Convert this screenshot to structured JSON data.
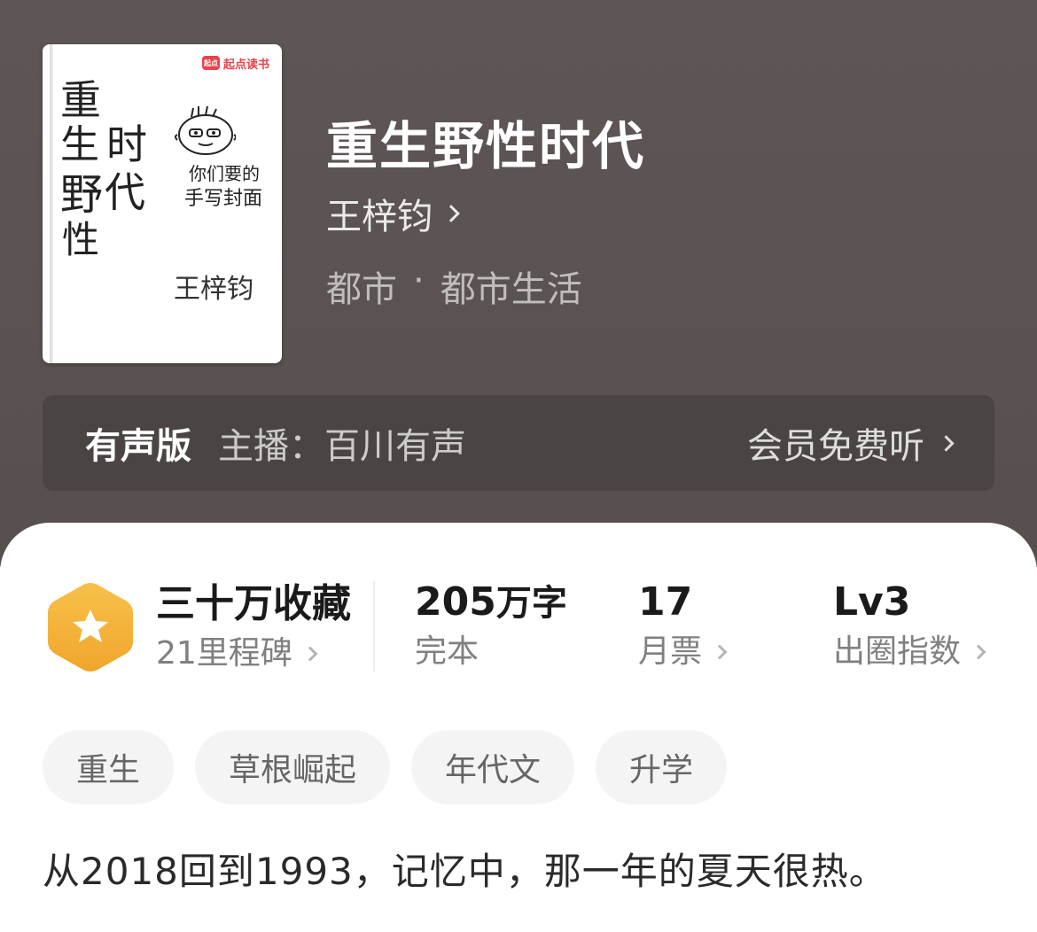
{
  "book": {
    "cover": {
      "brand": "起点读书",
      "brand_mini": "起点",
      "title_chars": [
        "重",
        "生",
        "时",
        "野",
        "性",
        "代"
      ],
      "caption_line1": "你们要的",
      "caption_line2": "手写封面",
      "signature": "王梓钧"
    },
    "title": "重生野性时代",
    "author": "王梓钧",
    "category": "都市",
    "separator": "·",
    "subcategory": "都市生活"
  },
  "audio": {
    "tag": "有声版",
    "narrator": "主播：百川有声",
    "action": "会员免费听"
  },
  "stats": {
    "collect_main": "三十万收藏",
    "collect_sub": "21里程碑",
    "words_num": "205",
    "words_unit": "万字",
    "status": "完本",
    "monthly_num": "17",
    "monthly_label": "月票",
    "level": "Lv3",
    "level_label": "出圈指数"
  },
  "tags": [
    "重生",
    "草根崛起",
    "年代文",
    "升学"
  ],
  "description": "从2018回到1993，记忆中，那一年的夏天很热。",
  "colors": {
    "hero_bg": "#5b5352",
    "audio_bg": "#4a4443",
    "badge": "#f4b63a",
    "brand_red": "#e8424a"
  }
}
